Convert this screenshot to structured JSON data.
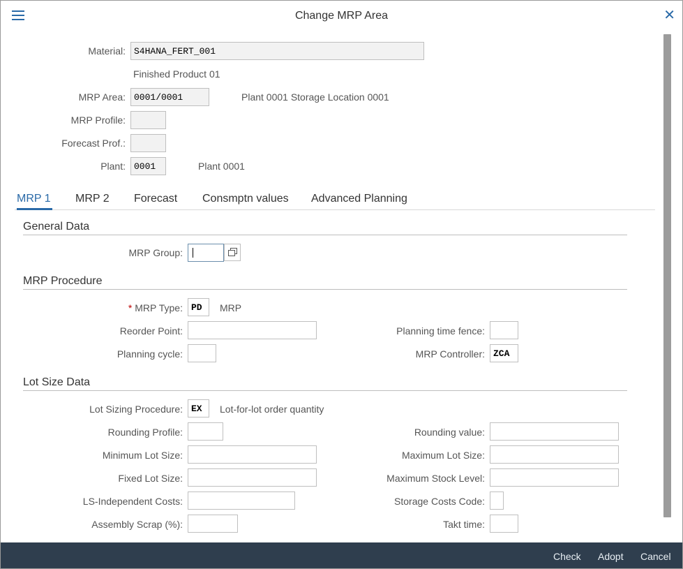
{
  "dialog": {
    "title": "Change MRP Area"
  },
  "header": {
    "material_label": "Material:",
    "material_value": "S4HANA_FERT_001",
    "material_desc": "Finished Product 01",
    "mrp_area_label": "MRP Area:",
    "mrp_area_value": "0001/0001",
    "mrp_area_desc": "Plant 0001 Storage Location 0001",
    "mrp_profile_label": "MRP Profile:",
    "mrp_profile_value": "",
    "forecast_prof_label": "Forecast Prof.:",
    "forecast_prof_value": "",
    "plant_label": "Plant:",
    "plant_value": "0001",
    "plant_desc": "Plant 0001"
  },
  "tabs": [
    {
      "label": "MRP 1",
      "active": true
    },
    {
      "label": "MRP 2"
    },
    {
      "label": "Forecast"
    },
    {
      "label": "Consmptn values"
    },
    {
      "label": "Advanced Planning"
    }
  ],
  "general": {
    "title": "General Data",
    "mrp_group_label": "MRP Group:",
    "mrp_group_value": ""
  },
  "procedure": {
    "title": "MRP Procedure",
    "mrp_type_required": "*",
    "mrp_type_label": "MRP Type:",
    "mrp_type_value": "PD",
    "mrp_type_desc": "MRP",
    "reorder_point_label": "Reorder Point:",
    "reorder_point_value": "",
    "planning_cycle_label": "Planning cycle:",
    "planning_cycle_value": "",
    "planning_time_fence_label": "Planning time fence:",
    "planning_time_fence_value": "",
    "mrp_controller_label": "MRP Controller:",
    "mrp_controller_value": "ZCA"
  },
  "lotsize": {
    "title": "Lot Size Data",
    "procedure_label": "Lot Sizing Procedure:",
    "procedure_value": "EX",
    "procedure_desc": "Lot-for-lot order quantity",
    "rounding_profile_label": "Rounding Profile:",
    "rounding_profile_value": "",
    "rounding_value_label": "Rounding value:",
    "rounding_value_value": "",
    "min_lot_label": "Minimum Lot Size:",
    "min_lot_value": "",
    "max_lot_label": "Maximum Lot Size:",
    "max_lot_value": "",
    "fixed_lot_label": "Fixed Lot Size:",
    "fixed_lot_value": "",
    "max_stock_label": "Maximum Stock Level:",
    "max_stock_value": "",
    "ls_costs_label": "LS-Independent Costs:",
    "ls_costs_value": "",
    "storage_costs_label": "Storage Costs Code:",
    "storage_costs_value": "",
    "assembly_scrap_label": "Assembly Scrap (%):",
    "assembly_scrap_value": "",
    "takt_time_label": "Takt time:",
    "takt_time_value": ""
  },
  "footer": {
    "check": "Check",
    "adopt": "Adopt",
    "cancel": "Cancel"
  },
  "colors": {
    "accent": "#2a6aa8",
    "footer_bg": "#2f3e4e"
  }
}
